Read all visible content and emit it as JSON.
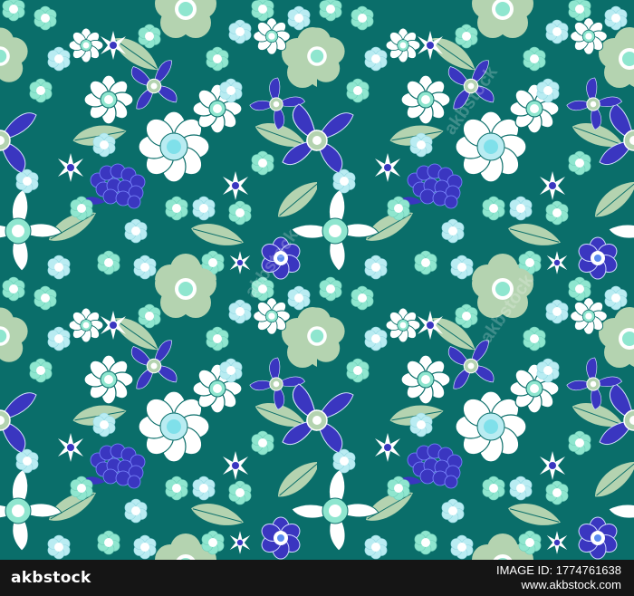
{
  "footer": {
    "brand": "akbstock",
    "image_id": "IMAGE ID: 1774761638",
    "site": "www.akbstock.com"
  },
  "watermark": {
    "text": "akbstock"
  },
  "colors": {
    "background": "#0a6e6a",
    "sage_leaf": "#b4d3b0",
    "mint_flower": "#8fe6cf",
    "light_cyan_flower": "#b9ecf2",
    "royal_blue": "#3a36c0",
    "white_petal": "#ffffff",
    "footer": "#151515"
  },
  "motifs": [
    "small-mint-flower",
    "white-daisy",
    "blue-lily",
    "sage-poppy",
    "white-lily",
    "blue-hyacinth",
    "star-flower",
    "sage-leaf"
  ]
}
